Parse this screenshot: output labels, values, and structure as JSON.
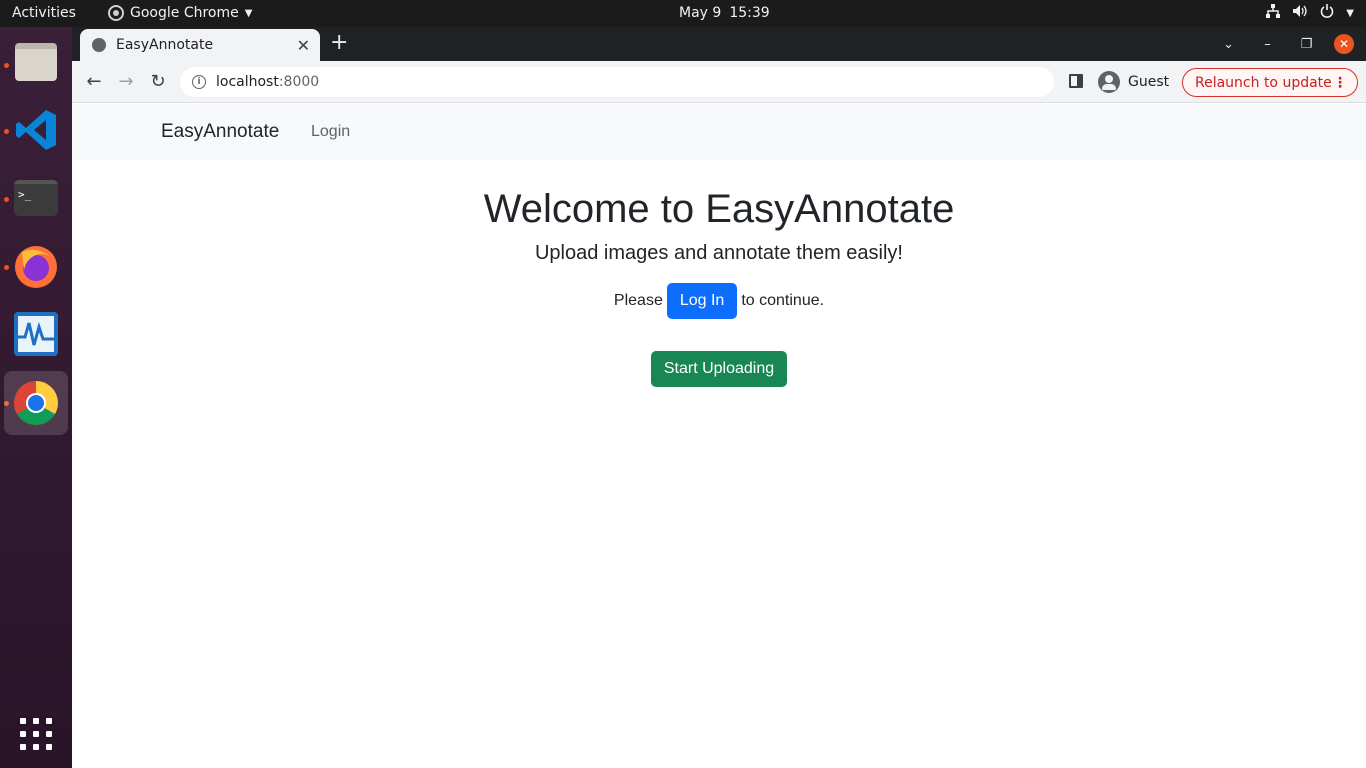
{
  "system": {
    "activities": "Activities",
    "app_name": "Google Chrome",
    "date": "May 9",
    "time": "15:39"
  },
  "browser": {
    "tab_title": "EasyAnnotate",
    "url_host": "localhost",
    "url_port": ":8000",
    "profile": "Guest",
    "relaunch": "Relaunch to update"
  },
  "site": {
    "brand": "EasyAnnotate",
    "nav_login": "Login",
    "heading": "Welcome to EasyAnnotate",
    "lead": "Upload images and annotate them easily!",
    "please": "Please",
    "login_button": "Log In",
    "continue": "to continue.",
    "upload_button": "Start Uploading"
  },
  "colors": {
    "primary": "#0d6efd",
    "success": "#198754",
    "ubuntu_orange": "#e95420"
  },
  "dock": [
    "files-icon",
    "vscode-icon",
    "terminal-icon",
    "firefox-icon",
    "system-monitor-icon",
    "chrome-icon"
  ]
}
